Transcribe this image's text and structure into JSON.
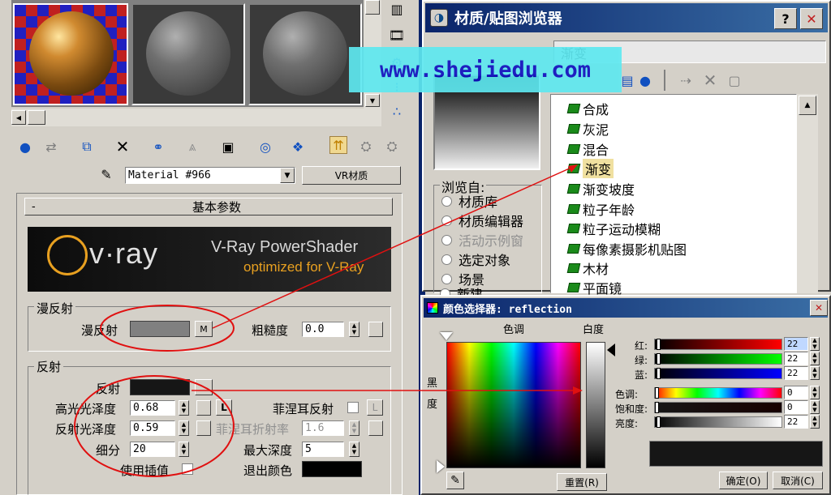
{
  "left_panel": {
    "material_name": "Material #966",
    "material_type": "VR材质",
    "rollout_title": "基本参数",
    "rollout_toggle": "-",
    "banner_brand": "v·ray",
    "banner_line1": "V-Ray PowerShader",
    "banner_line2": "optimized for V-Ray",
    "diffuse_group": "漫反射",
    "diffuse_label": "漫反射",
    "diffuse_map_btn": "M",
    "roughness_label": "粗糙度",
    "roughness_value": "0.0",
    "reflect_group": "反射",
    "reflect_label": "反射",
    "hilight_gloss_label": "高光光泽度",
    "hilight_gloss_value": "0.68",
    "lock_btn": "L",
    "refl_gloss_label": "反射光泽度",
    "refl_gloss_value": "0.59",
    "subdivs_label": "细分",
    "subdivs_value": "20",
    "use_interp_label": "使用插值",
    "fresnel_label": "菲涅耳反射",
    "fresnel_lock_btn": "L",
    "fresnel_ior_label": "菲涅耳折射率",
    "fresnel_ior_value": "1.6",
    "max_depth_label": "最大深度",
    "max_depth_value": "5",
    "exit_color_label": "退出颜色"
  },
  "watermark": "www.shejiedu.com",
  "browser": {
    "title": "材质/贴图浏览器",
    "help_btn": "?",
    "close_btn": "✕",
    "selected_name": "渐变",
    "browse_from_label": "浏览自:",
    "browse_options": [
      "材质库",
      "材质编辑器",
      "活动示例窗",
      "选定对象",
      "场景",
      "新建"
    ],
    "list_items": [
      "合成",
      "灰泥",
      "混合",
      "渐变",
      "渐变坡度",
      "粒子年龄",
      "粒子运动模糊",
      "每像素摄影机贴图",
      "木材",
      "平面镜"
    ]
  },
  "color_picker": {
    "title": "颜色选择器: reflection",
    "close_btn": "✕",
    "hue_label": "色调",
    "whiteness_label": "白度",
    "black_label": "黑",
    "degree_label": "度",
    "red_label": "红:",
    "green_label": "绿:",
    "blue_label": "蓝:",
    "hue_channel_label": "色调:",
    "sat_label": "饱和度:",
    "value_label": "亮度:",
    "red_value": "22",
    "green_value": "22",
    "blue_value": "22",
    "hue_value": "0",
    "sat_value": "0",
    "val_value": "22",
    "reset_btn": "重置(R)",
    "ok_btn": "确定(O)",
    "cancel_btn": "取消(C)"
  },
  "colors": {
    "window_bg": "#d4d0c8",
    "title_active": "#0a246a",
    "annotation_red": "#e01010",
    "watermark_bg": "#5ee8f0",
    "watermark_text": "#1010c0"
  }
}
